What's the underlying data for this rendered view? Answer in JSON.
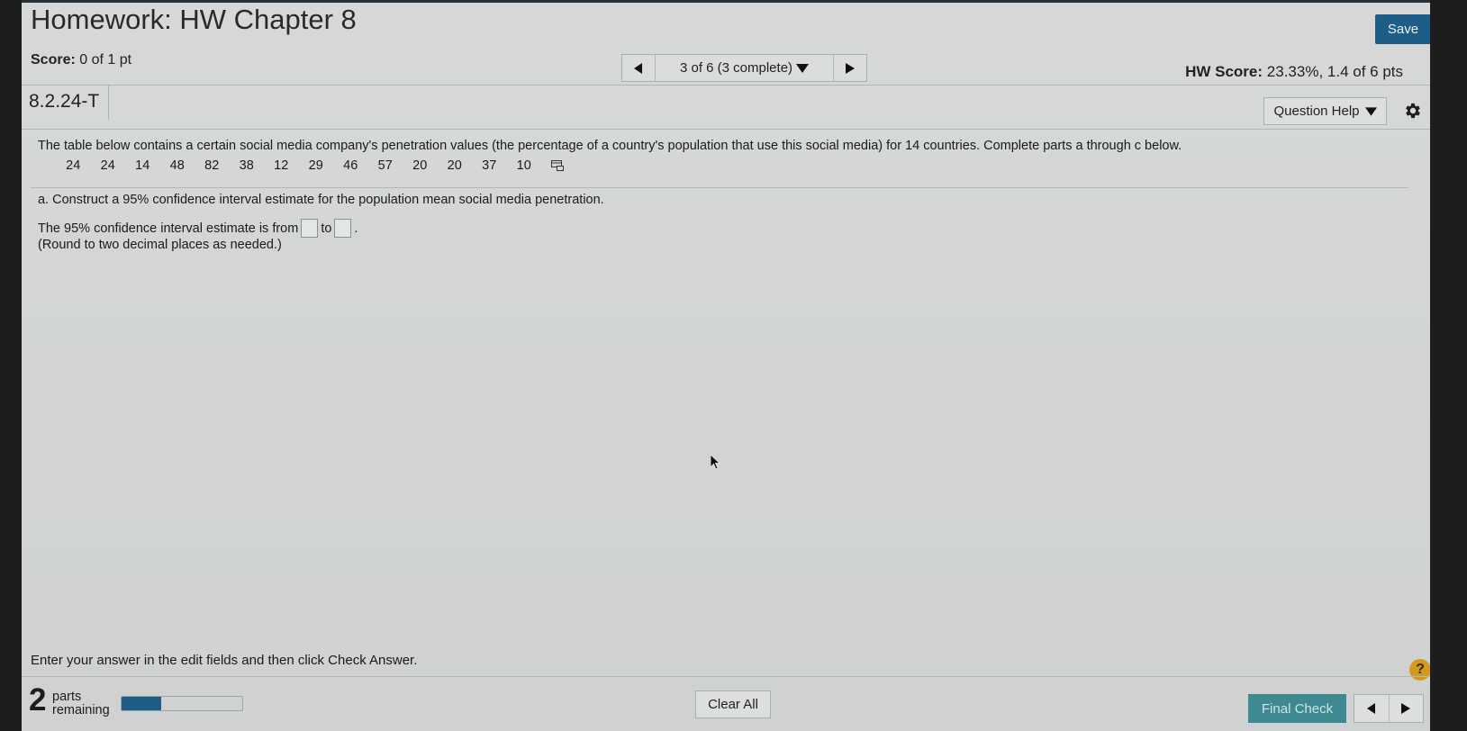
{
  "header": {
    "title": "Homework: HW Chapter 8",
    "save_label": "Save",
    "score_label": "Score:",
    "score_value": "0 of 1 pt",
    "hw_score_label": "HW Score:",
    "hw_score_value": "23.33%, 1.4 of 6 pts"
  },
  "navigation": {
    "position_label": "3 of 6 (3 complete)"
  },
  "question": {
    "id": "8.2.24-T",
    "help_label": "Question Help",
    "prompt": "The table below contains a certain social media company's penetration values (the percentage of a country's population that use this social media) for 14 countries. Complete parts a through c below.",
    "data_values": [
      "24",
      "24",
      "14",
      "48",
      "82",
      "38",
      "12",
      "29",
      "46",
      "57",
      "20",
      "20",
      "37",
      "10"
    ],
    "part_a": "a. Construct a 95% confidence interval estimate for the population mean social media penetration.",
    "ci_prefix": "The 95% confidence interval estimate is from",
    "ci_middle": "to",
    "ci_suffix": ".",
    "round_note": "(Round to two decimal places as needed.)"
  },
  "footer": {
    "instruction": "Enter your answer in the edit fields and then click Check Answer.",
    "help_symbol": "?",
    "parts_remaining_number": "2",
    "parts_word": "parts",
    "remaining_word": "remaining",
    "progress_fraction": 0.33,
    "clear_label": "Clear All",
    "final_label": "Final Check"
  },
  "icons": {
    "prev": "triangle-left",
    "next": "triangle-right",
    "dropdown": "triangle-down",
    "settings": "gear",
    "copy": "copy-data"
  },
  "colors": {
    "save_button": "#1f5d89",
    "final_check_button": "#3f8a92",
    "progress_fill": "#1f5d89",
    "help_circle": "#d49a1e"
  }
}
